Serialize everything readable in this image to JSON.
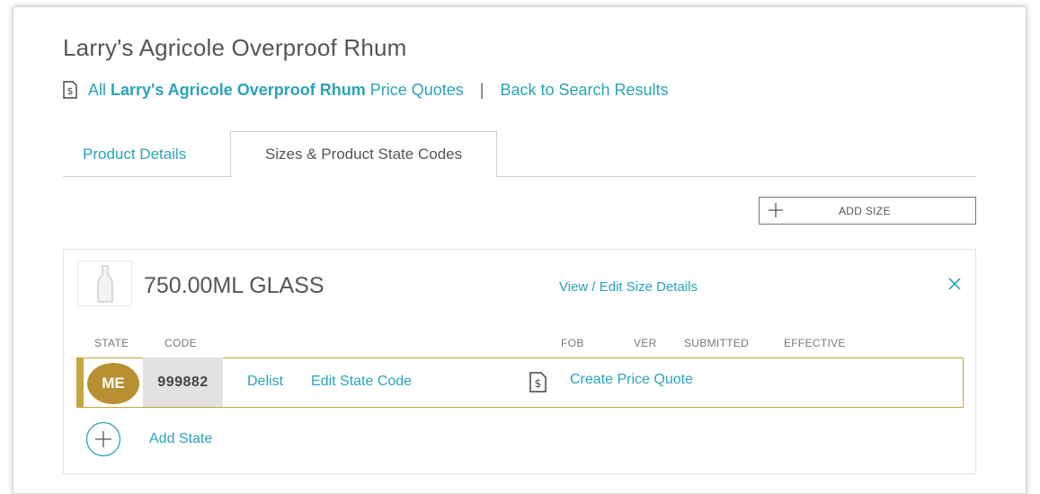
{
  "product": {
    "title": "Larry's Agricole Overproof Rhum"
  },
  "subnav": {
    "all_prefix": "All",
    "product_name": "Larry's Agricole Overproof Rhum",
    "all_suffix": "Price Quotes",
    "separator": "|",
    "back_label": "Back to Search Results",
    "doc_icon": "price-document-icon"
  },
  "tabs": [
    {
      "label": "Product Details",
      "active": false
    },
    {
      "label": "Sizes & Product State Codes",
      "active": true
    }
  ],
  "toolbar": {
    "add_size_label": "ADD SIZE",
    "add_size_icon": "plus-icon"
  },
  "size": {
    "name": "750.00ML GLASS",
    "thumb_icon": "bottle-icon",
    "view_edit_label": "View / Edit Size Details",
    "close_icon": "close-icon",
    "columns": {
      "state": "STATE",
      "code": "CODE",
      "fob": "FOB",
      "ver": "VER",
      "submitted": "SUBMITTED",
      "effective": "EFFECTIVE"
    },
    "rows": [
      {
        "state": "ME",
        "code": "999882",
        "delist_label": "Delist",
        "edit_label": "Edit State Code",
        "quote_icon": "price-quote-icon",
        "create_quote_label": "Create Price Quote"
      }
    ],
    "add_state_label": "Add State",
    "add_state_icon": "plus-circle-icon"
  },
  "colors": {
    "link": "#2aa3b8",
    "state_accent": "#c4a63d",
    "badge": "#b89032",
    "code_bg": "#e2e2e2"
  }
}
